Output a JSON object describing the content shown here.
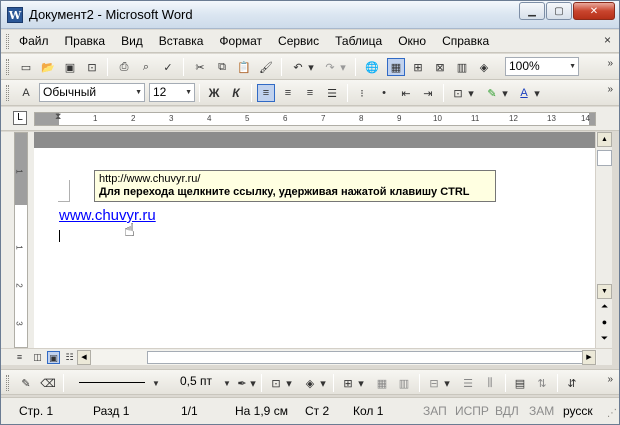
{
  "window": {
    "title": "Документ2 - Microsoft Word",
    "app_icon_letter": "W"
  },
  "menu": {
    "items": [
      "Файл",
      "Правка",
      "Вид",
      "Вставка",
      "Формат",
      "Сервис",
      "Таблица",
      "Окно",
      "Справка"
    ],
    "close_glyph": "×"
  },
  "toolbar_standard": {
    "zoom": "100%"
  },
  "toolbar_formatting": {
    "style": "Обычный",
    "font_size": "12",
    "bold": "Ж",
    "italic": "К"
  },
  "ruler": {
    "corner_symbol": "L",
    "ticks": [
      "1",
      "2",
      "3",
      "4",
      "5",
      "6",
      "7",
      "8",
      "9",
      "10",
      "11",
      "12",
      "13",
      "14"
    ],
    "vertical_ticks": [
      "1",
      "1",
      "2",
      "3"
    ]
  },
  "document": {
    "hyperlink_text": "www.chuvyr.ru",
    "tooltip_url": "http://www.chuvyr.ru/",
    "tooltip_hint": "Для перехода щелкните ссылку, удерживая нажатой клавишу CTRL"
  },
  "drawing_toolbar": {
    "line_width": "0,5 пт"
  },
  "status": {
    "page": "Стр. 1",
    "section": "Разд 1",
    "pages": "1/1",
    "position": "На 1,9 см",
    "line": "Ст 2",
    "column": "Кол 1",
    "rec": "ЗАП",
    "trk": "ИСПР",
    "ext": "ВДЛ",
    "ovr": "ЗАМ",
    "language": "русск"
  },
  "colors": {
    "hyperlink": "#0000ff",
    "tooltip_bg": "#ffffe1",
    "close_button": "#c9452e"
  }
}
